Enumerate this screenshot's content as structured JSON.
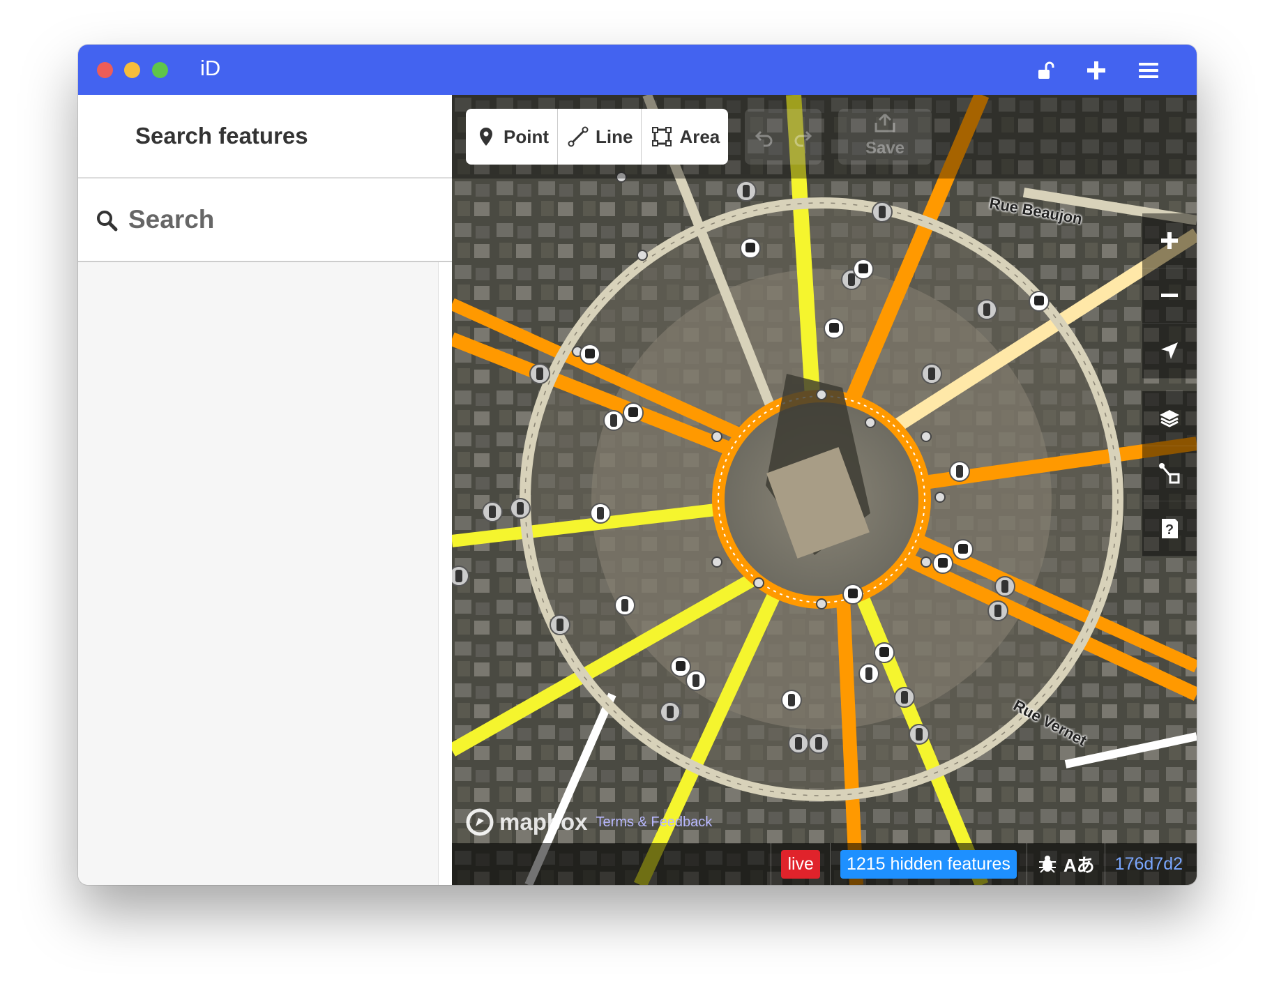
{
  "window": {
    "title": "iD"
  },
  "titlebar": {
    "icons": [
      "lock-open-icon",
      "plus-icon",
      "hamburger-menu-icon"
    ]
  },
  "sidebar": {
    "header": "Search features",
    "search_placeholder": "Search"
  },
  "toolbar": {
    "modes": [
      {
        "label": "Point",
        "icon": "pin-icon"
      },
      {
        "label": "Line",
        "icon": "line-icon"
      },
      {
        "label": "Area",
        "icon": "area-icon"
      }
    ],
    "undo_icon": "undo-icon",
    "redo_icon": "redo-icon",
    "save_label": "Save"
  },
  "map_controls": [
    "zoom-in-icon",
    "zoom-out-icon",
    "geolocate-icon",
    "layers-icon",
    "map-data-icon",
    "help-icon"
  ],
  "map": {
    "street_labels": [
      "Rue Beaujon",
      "Rue Vernet"
    ],
    "colors": {
      "primary": "#ff9900",
      "secondary": "#f5f52e",
      "tertiary": "#ffe8a8",
      "residential": "#d8d2ba"
    }
  },
  "footer": {
    "mapbox_label": "mapbox",
    "attribution": "Terms & Feedback",
    "live_badge": "live",
    "hidden_features": "1215 hidden features",
    "language_icon": "Aあ",
    "version": "176d7d2"
  }
}
